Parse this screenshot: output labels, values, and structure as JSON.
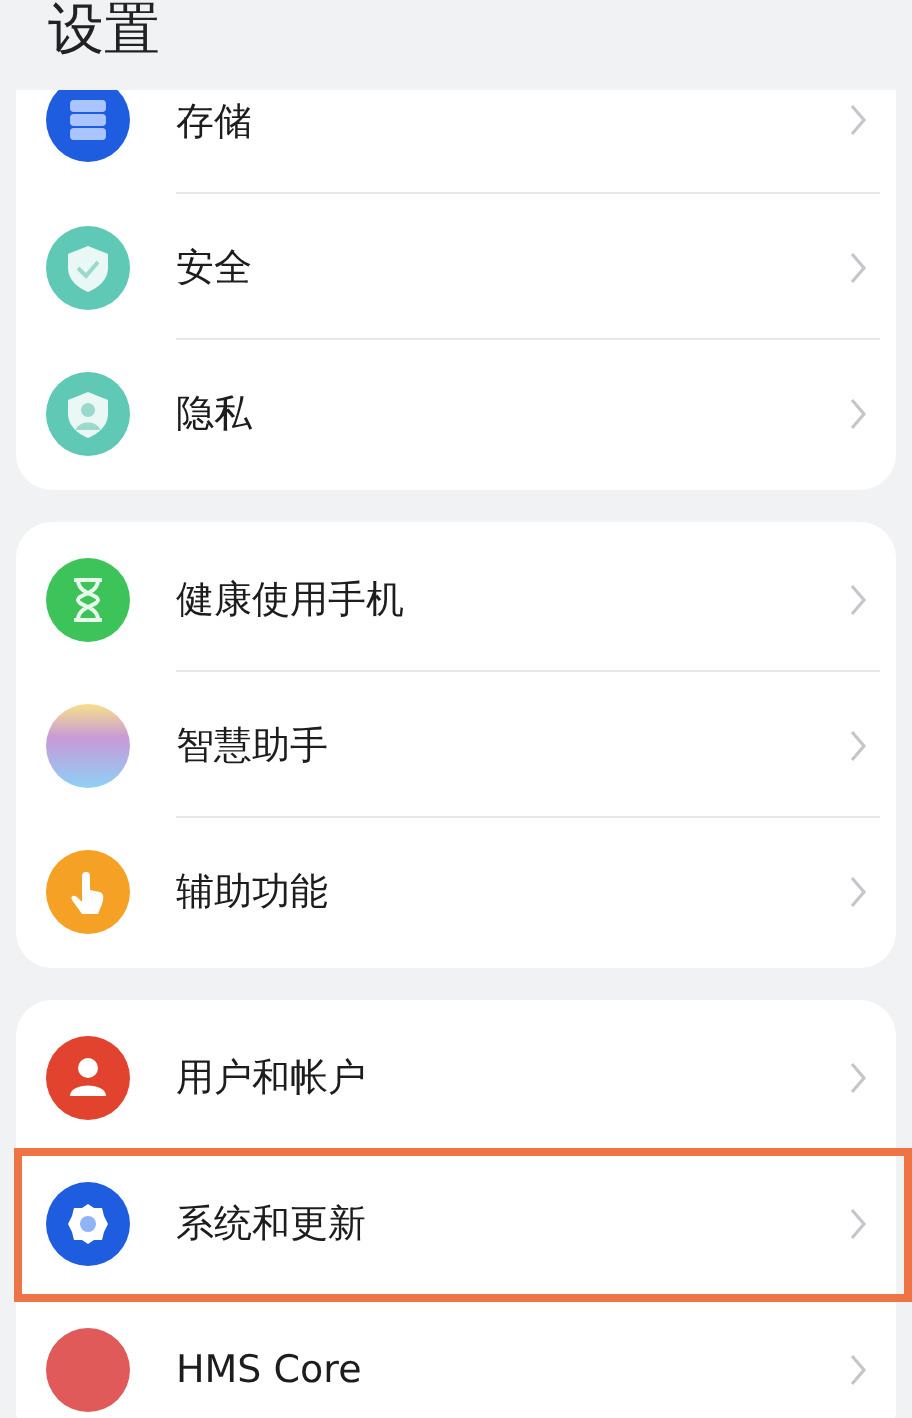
{
  "header": {
    "title": "设置"
  },
  "groups": [
    {
      "items": [
        {
          "label": "存储",
          "kind": "storage",
          "color": "#1f5de0",
          "highlighted": false
        },
        {
          "label": "安全",
          "kind": "shield-check",
          "color": "#5fc9b6",
          "highlighted": false
        },
        {
          "label": "隐私",
          "kind": "shield-person",
          "color": "#5fc9b6",
          "highlighted": false
        }
      ]
    },
    {
      "items": [
        {
          "label": "健康使用手机",
          "kind": "hourglass",
          "color": "#3cc45a",
          "highlighted": false
        },
        {
          "label": "智慧助手",
          "kind": "orb",
          "color": "#c79ad8",
          "highlighted": false
        },
        {
          "label": "辅助功能",
          "kind": "hand",
          "color": "#f4a126",
          "highlighted": false
        }
      ]
    },
    {
      "items": [
        {
          "label": "用户和帐户",
          "kind": "person",
          "color": "#e2432f",
          "highlighted": false
        },
        {
          "label": "系统和更新",
          "kind": "gear",
          "color": "#1f5de0",
          "highlighted": true
        },
        {
          "label": "HMS Core",
          "kind": "badge",
          "color": "#e05a5a",
          "highlighted": false
        }
      ]
    }
  ]
}
